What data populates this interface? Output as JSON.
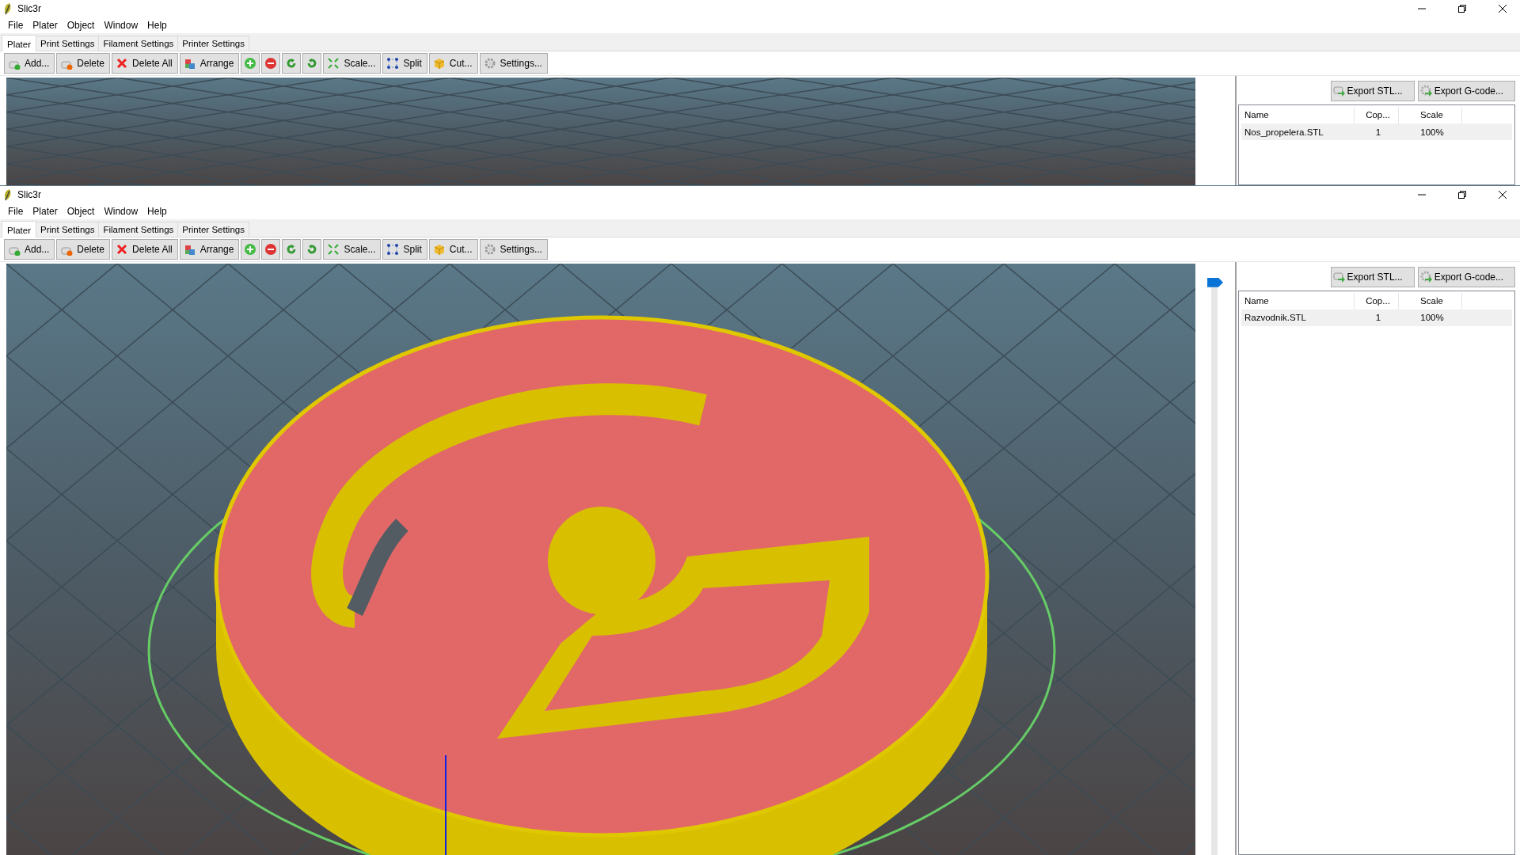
{
  "windows": [
    {
      "title": "Slic3r",
      "menu": [
        "File",
        "Plater",
        "Object",
        "Window",
        "Help"
      ],
      "tabs": [
        {
          "label": "Plater",
          "selected": true
        },
        {
          "label": "Print Settings",
          "selected": false
        },
        {
          "label": "Filament Settings",
          "selected": false
        },
        {
          "label": "Printer Settings",
          "selected": false
        }
      ],
      "toolbar": [
        {
          "kind": "text",
          "label": "Add..."
        },
        {
          "kind": "text",
          "label": "Delete"
        },
        {
          "kind": "text",
          "label": "Delete All"
        },
        {
          "kind": "text",
          "label": "Arrange"
        },
        {
          "kind": "icon"
        },
        {
          "kind": "icon"
        },
        {
          "kind": "icon"
        },
        {
          "kind": "icon"
        },
        {
          "kind": "text",
          "label": "Scale..."
        },
        {
          "kind": "text",
          "label": "Split"
        },
        {
          "kind": "text",
          "label": "Cut..."
        },
        {
          "kind": "text",
          "label": "Settings..."
        }
      ],
      "viewport": {
        "model": false
      },
      "export_buttons": [
        "Export STL...",
        "Export G-code..."
      ],
      "objects": {
        "columns": [
          "Name",
          "Cop...",
          "Scale"
        ],
        "rows": [
          {
            "cells": [
              "Nos_propelera.STL",
              "1",
              "100%"
            ],
            "selected": true
          }
        ]
      }
    },
    {
      "title": "Slic3r",
      "menu": [
        "File",
        "Plater",
        "Object",
        "Window",
        "Help"
      ],
      "tabs": [
        {
          "label": "Plater",
          "selected": true
        },
        {
          "label": "Print Settings",
          "selected": false
        },
        {
          "label": "Filament Settings",
          "selected": false
        },
        {
          "label": "Printer Settings",
          "selected": false
        }
      ],
      "toolbar": [
        {
          "kind": "text",
          "label": "Add..."
        },
        {
          "kind": "text",
          "label": "Delete"
        },
        {
          "kind": "text",
          "label": "Delete All"
        },
        {
          "kind": "text",
          "label": "Arrange"
        },
        {
          "kind": "icon"
        },
        {
          "kind": "icon"
        },
        {
          "kind": "icon"
        },
        {
          "kind": "icon"
        },
        {
          "kind": "text",
          "label": "Scale..."
        },
        {
          "kind": "text",
          "label": "Split"
        },
        {
          "kind": "text",
          "label": "Cut..."
        },
        {
          "kind": "text",
          "label": "Settings..."
        }
      ],
      "viewport": {
        "model": true
      },
      "layer_slider": {
        "level": 1
      },
      "export_buttons": [
        "Export STL...",
        "Export G-code..."
      ],
      "objects": {
        "columns": [
          "Name",
          "Cop...",
          "Scale"
        ],
        "rows": [
          {
            "cells": [
              "Razvodnik.STL",
              "1",
              "100%"
            ],
            "selected": true
          }
        ]
      }
    }
  ]
}
